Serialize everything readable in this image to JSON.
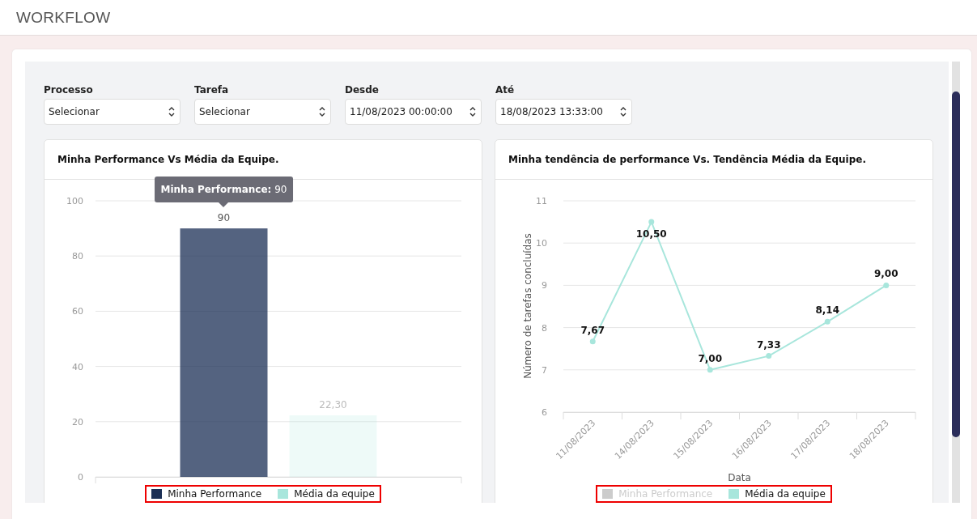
{
  "header": {
    "title": "WORKFLOW"
  },
  "filters": [
    {
      "label": "Processo",
      "value": "Selecionar"
    },
    {
      "label": "Tarefa",
      "value": "Selecionar"
    },
    {
      "label": "Desde",
      "value": "11/08/2023 00:00:00"
    },
    {
      "label": "Até",
      "value": "18/08/2023 13:33:00"
    }
  ],
  "performance_card": {
    "title": "Minha Performance Vs Média da Equipe.",
    "chart_data": {
      "type": "bar",
      "ylim": [
        0,
        100
      ],
      "yticks": [
        0,
        20,
        40,
        60,
        80,
        100
      ],
      "categories": [
        null
      ],
      "grid": true,
      "series": [
        {
          "name": "Minha Performance",
          "color": "#1b2f55",
          "values": [
            90
          ]
        },
        {
          "name": "Média da equipe",
          "color": "#a8e6dc",
          "values": [
            22.3
          ]
        }
      ],
      "value_labels": [
        "90",
        "22,30"
      ]
    },
    "tooltip": {
      "text": "**Minha Performance:** 90"
    }
  },
  "trend_card": {
    "title": "Minha tendência de performance Vs. Tendência Média da Equipe.",
    "chart_data": {
      "type": "line",
      "xlabel": "Data",
      "ylabel": "Número de tarefas concluídas",
      "ylim": [
        6,
        11
      ],
      "yticks": [
        6,
        7,
        8,
        9,
        10,
        11
      ],
      "grid": true,
      "categories": [
        "11/08/2023",
        "14/08/2023",
        "15/08/2023",
        "16/08/2023",
        "17/08/2023",
        "18/08/2023"
      ],
      "series": [
        {
          "name": "Minha Performance",
          "color": "#cccccc",
          "values": [
            null,
            null,
            null,
            null,
            null,
            null
          ]
        },
        {
          "name": "Média da equipe",
          "color": "#a8e6dc",
          "marker": "circle",
          "values": [
            7.67,
            10.5,
            7,
            7.33,
            8.14,
            9
          ]
        }
      ],
      "value_labels": [
        "7,67",
        "10,50",
        "7,00",
        "7,33",
        "8,14",
        "9,00"
      ]
    }
  }
}
